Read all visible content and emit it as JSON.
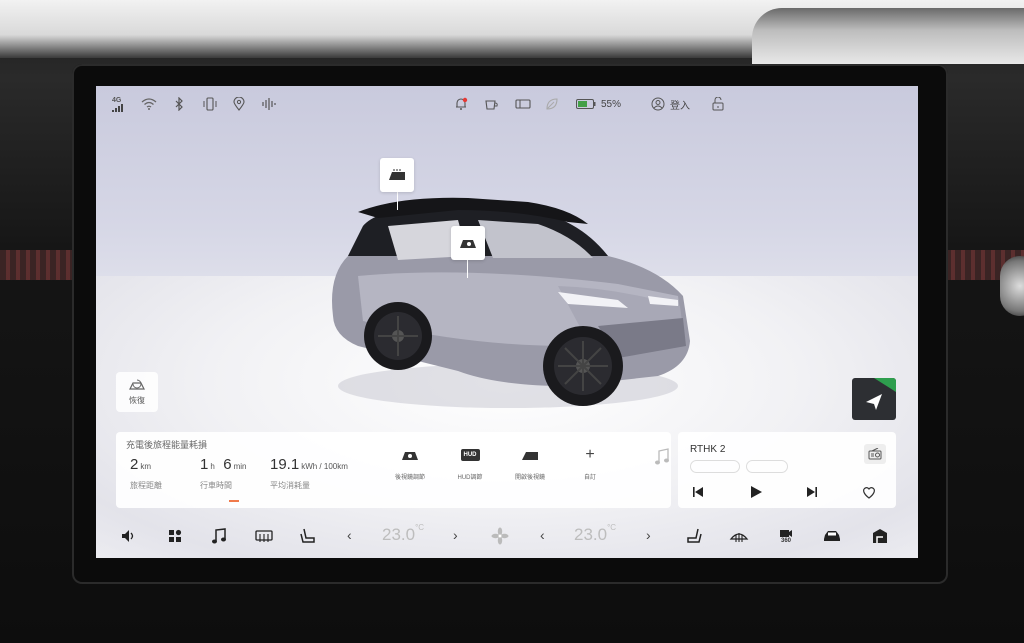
{
  "status_bar": {
    "network": "4G",
    "battery_percent": "55%",
    "login_label": "登入",
    "icons": [
      "signal-icon",
      "wifi-icon",
      "bluetooth-icon",
      "phone-vibrate-icon",
      "location-icon",
      "audio-wave-icon",
      "notification-bell-icon",
      "coffee-cup-icon",
      "display-icon",
      "leaf-icon",
      "battery-icon",
      "user-icon",
      "unlock-icon"
    ]
  },
  "scene": {
    "restore_label": "恢復",
    "tags": [
      "rear-window-icon",
      "seat-camera-icon"
    ]
  },
  "trip": {
    "title": "充電後旅程能量耗損",
    "stats": [
      {
        "value": "2",
        "unit": "km",
        "label": "旅程距離"
      },
      {
        "value_h": "1",
        "unit_h": "h",
        "value_m": "6",
        "unit_m": "min",
        "label": "行車時間"
      },
      {
        "value": "19.1",
        "unit": "kWh / 100km",
        "label": "平均消耗量"
      }
    ]
  },
  "quick_actions": [
    {
      "label": "後視鏡調節",
      "icon": "mirror-adjust-icon"
    },
    {
      "label": "HUD調節",
      "icon": "hud-icon",
      "icon_text": "HUD"
    },
    {
      "label": "開啟後視鏡",
      "icon": "mirror-fold-icon"
    },
    {
      "label": "自訂",
      "icon": "plus-icon",
      "icon_text": "+"
    }
  ],
  "media": {
    "station": "RTHK 2",
    "pill_left": "",
    "pill_right": "",
    "icons": [
      "music-note-icon",
      "radio-icon",
      "previous-icon",
      "play-icon",
      "next-icon",
      "heart-icon"
    ]
  },
  "climate": {
    "driver_temp": "23.0",
    "passenger_temp": "23.0",
    "unit": "°C"
  },
  "bottom_bar": {
    "icons": [
      "volume-icon",
      "apps-icon",
      "music-icon",
      "rear-defrost-icon",
      "seat-heat-icon",
      "fan-icon",
      "seat-heat-right-icon",
      "front-defrost-icon",
      "camera-360-icon",
      "car-icon",
      "home-icon"
    ],
    "camera_label": "360"
  },
  "colors": {
    "accent": "#f07a4a",
    "notification_dot": "#e53935",
    "battery_fill": "#43a047",
    "nav_green": "#2e9e4e"
  }
}
